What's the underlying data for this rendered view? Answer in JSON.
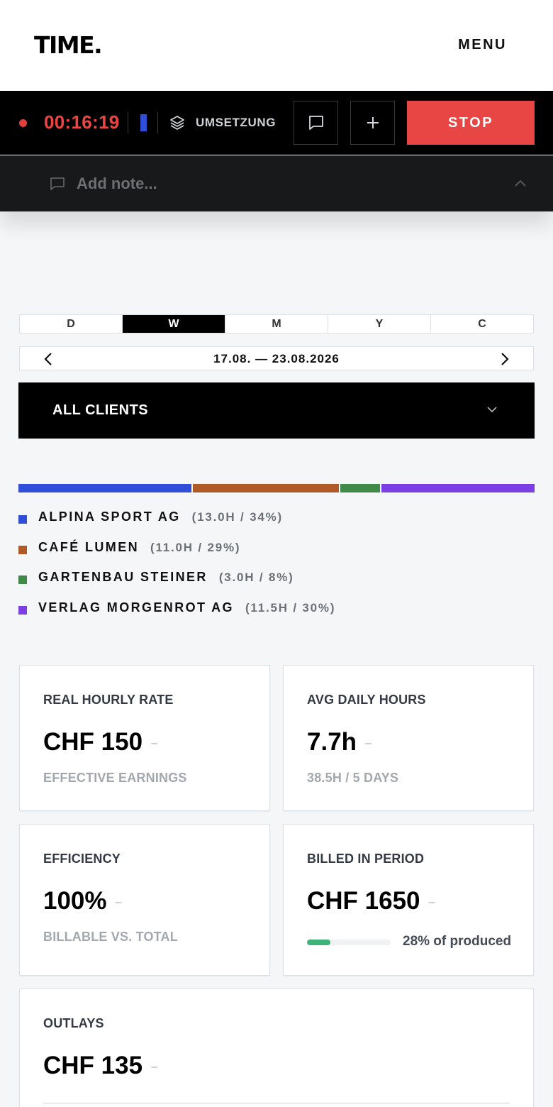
{
  "header": {
    "logo": "TIME.",
    "menu_label": "MENU"
  },
  "timer": {
    "elapsed": "00:16:19",
    "project_name": "UMSETZUNG",
    "project_color": "#2f4fd8",
    "stop_label": "STOP",
    "note_placeholder": "Add note..."
  },
  "period_tabs": [
    {
      "label": "D",
      "active": false
    },
    {
      "label": "W",
      "active": true
    },
    {
      "label": "M",
      "active": false
    },
    {
      "label": "Y",
      "active": false
    },
    {
      "label": "C",
      "active": false
    }
  ],
  "date_range": "17.08. — 23.08.2026",
  "client_filter": {
    "selected": "ALL CLIENTS"
  },
  "distribution": [
    {
      "name": "ALPINA SPORT AG",
      "stat": "(13.0H / 34%)",
      "hours": 13.0,
      "color": "#2f4fd8"
    },
    {
      "name": "CAFÉ LUMEN",
      "stat": "(11.0H / 29%)",
      "hours": 11.0,
      "color": "#b05a2a"
    },
    {
      "name": "GARTENBAU STEINER",
      "stat": "(3.0H / 8%)",
      "hours": 3.0,
      "color": "#3f8a48"
    },
    {
      "name": "VERLAG MORGENROT AG",
      "stat": "(11.5H / 30%)",
      "hours": 11.5,
      "color": "#7b3fe4"
    }
  ],
  "cards": {
    "hourly_rate": {
      "title": "REAL HOURLY RATE",
      "value": "CHF 150",
      "dash": "–",
      "sub": "EFFECTIVE EARNINGS"
    },
    "avg_daily": {
      "title": "AVG DAILY HOURS",
      "value": "7.7h",
      "dash": "–",
      "sub": "38.5H / 5 DAYS"
    },
    "efficiency": {
      "title": "EFFICIENCY",
      "value": "100%",
      "dash": "–",
      "sub": "BILLABLE VS. TOTAL"
    },
    "billed": {
      "title": "BILLED IN PERIOD",
      "value": "CHF 1650",
      "dash": "–",
      "progress_label": "28% of produced",
      "progress": 0.28
    },
    "outlays": {
      "title": "OUTLAYS",
      "value": "CHF 135",
      "dash": "–"
    }
  }
}
